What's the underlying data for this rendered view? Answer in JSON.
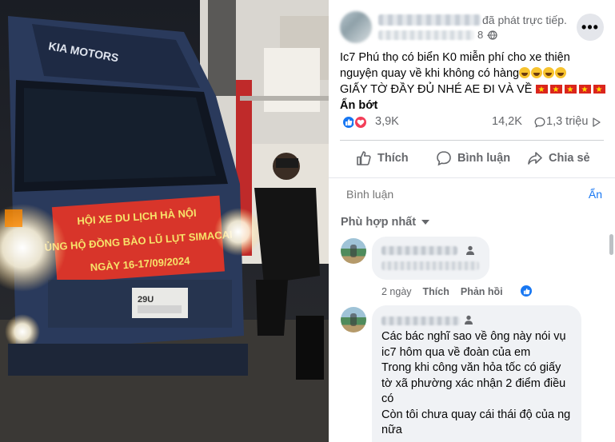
{
  "post": {
    "live_text": "đã phát trực tiếp.",
    "time_suffix": "8 ·",
    "more_label": "•••",
    "text_line1": "Ic7 Phú thọ có biển K0 miễn phí cho xe thiện",
    "text_line2": "nguyện quay về khi không có hàng",
    "text_line3": "GIẤY TỜ ĐẦY ĐỦ NHÉ AE ĐI VÀ VỀ",
    "see_less": "Ẩn bớt",
    "emoji_count_line2": 4,
    "flag_count_line3": 5
  },
  "stats": {
    "reactions": "3,9K",
    "comments": "14,2K",
    "views": "1,3 triệu"
  },
  "actions": {
    "like": "Thích",
    "comment": "Bình luận",
    "share": "Chia sẻ"
  },
  "comment_box": {
    "placeholder": "Bình luận",
    "hide": "Ẩn"
  },
  "sort_label": "Phù hợp nhất",
  "comments": [
    {
      "time": "2 ngày",
      "like": "Thích",
      "reply": "Phản hồi"
    },
    {
      "lines": [
        "Các bác nghĩ sao về ông này nói vụ",
        "ic7 hôm qua về đoàn của em",
        "Trong khi công văn hỏa tốc có giấy",
        "tờ xã phường xác nhận 2 điểm điều",
        "có",
        "Còn tôi chưa quay cái thái độ của ng",
        "nữa"
      ]
    }
  ],
  "photo": {
    "truck_brand": "KIA MOTORS",
    "banner_line1": "HỘI XE DU LỊCH HÀ NỘI",
    "banner_line2": "ỦNG HỘ ĐỒNG BÀO LŨ LỤT SIMACAI",
    "banner_line3": "NGÀY 16-17/09/2024",
    "plate_partial": "29U"
  },
  "colors": {
    "accent": "#1877f2",
    "love": "#f33e58",
    "banner": "#d8352a",
    "banner_text": "#f7e36a",
    "truck": "#2a3a5c"
  }
}
